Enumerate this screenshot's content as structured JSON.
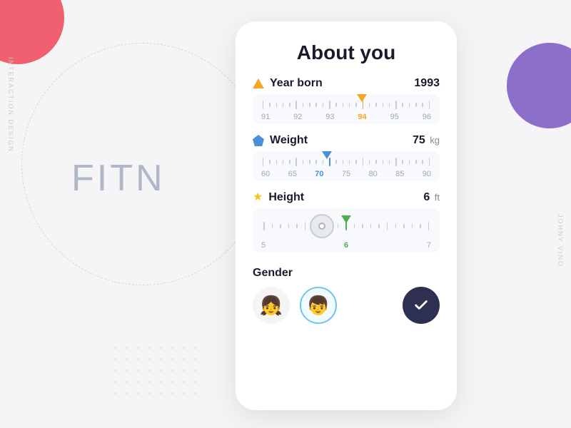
{
  "page": {
    "background": {
      "side_text_left": "INTERACTION DESIGN",
      "side_text_right": "JOHNY VINO",
      "logo_text": "FITN"
    },
    "card": {
      "title": "About you",
      "sections": {
        "year_born": {
          "label": "Year born",
          "value": "1993",
          "unit": "",
          "icon": "triangle-icon",
          "slider": {
            "labels": [
              "91",
              "92",
              "93",
              "94",
              "95",
              "96"
            ],
            "active_index": 3,
            "active_label": "94",
            "marker_color": "orange"
          }
        },
        "weight": {
          "label": "Weight",
          "value": "75",
          "unit": "kg",
          "icon": "pentagon-icon",
          "slider": {
            "labels": [
              "60",
              "65",
              "70",
              "75",
              "80",
              "85",
              "90"
            ],
            "active_index": 3,
            "active_label": "70",
            "marker_color": "blue"
          }
        },
        "height": {
          "label": "Height",
          "value": "6",
          "unit": "ft",
          "icon": "star-icon",
          "slider": {
            "labels": [
              "5",
              "6",
              "7"
            ],
            "active_index": 1,
            "active_label": "6",
            "marker_color": "green"
          }
        }
      },
      "gender": {
        "title": "Gender",
        "options": [
          {
            "id": "female",
            "emoji": "👧",
            "active": false
          },
          {
            "id": "male",
            "emoji": "👦",
            "active": true
          }
        ],
        "confirm_label": "✓"
      }
    }
  }
}
